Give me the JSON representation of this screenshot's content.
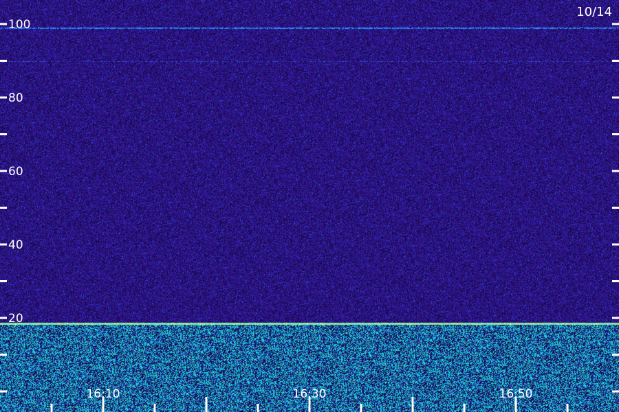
{
  "chart_data": {
    "type": "heatmap",
    "date_label": "10/14",
    "xlabel": "",
    "ylabel": "",
    "x_axis": {
      "start": "16:00",
      "end": "17:00",
      "major_ticks": [
        "16:10",
        "16:20",
        "16:30",
        "16:40",
        "16:50"
      ],
      "labeled_ticks": [
        "16:10",
        "16:30",
        "16:50"
      ],
      "minor_tick_interval_min": 5
    },
    "y_axis": {
      "range": [
        0,
        100
      ],
      "ticks": [
        0,
        10,
        20,
        30,
        40,
        50,
        60,
        70,
        80,
        90,
        100
      ],
      "labeled_ticks": [
        20,
        40,
        60,
        80,
        100
      ]
    },
    "features": [
      {
        "kind": "horizontal_line",
        "y": 99,
        "intensity": "medium"
      },
      {
        "kind": "horizontal_line",
        "y": 90,
        "intensity": "weak"
      },
      {
        "kind": "band_edge",
        "y": 18.5,
        "intensity": "strong"
      },
      {
        "kind": "band",
        "y_range": [
          2,
          18
        ],
        "intensity": "high"
      }
    ],
    "colors": {
      "background": "#1a0c5c",
      "noise_low": "#0a0033",
      "noise_high": "#3a2ad0",
      "signal": "#3aa0ff",
      "strong": "#40ffb0",
      "peak": "#ffff60",
      "axis": "#ffffff"
    },
    "grid": false
  }
}
